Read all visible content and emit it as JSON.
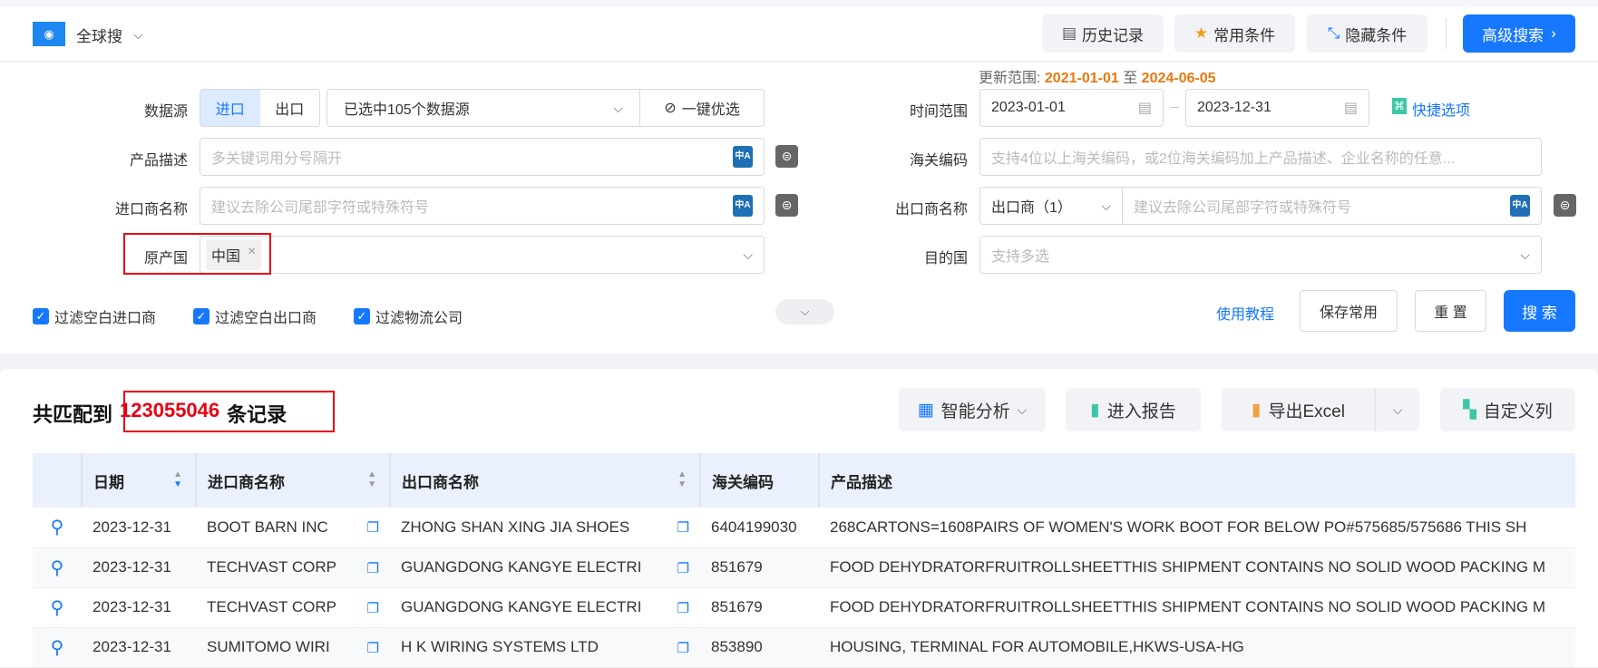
{
  "header": {
    "scope": "全球搜",
    "buttons": {
      "history": "历史记录",
      "favorites": "常用条件",
      "hide": "隐藏条件",
      "advanced": "高级搜索"
    }
  },
  "form": {
    "update_range_label": "更新范围:",
    "update_start": "2021-01-01",
    "update_to": "至",
    "update_end": "2024-06-05",
    "data_source_label": "数据源",
    "import_label": "进口",
    "export_label": "出口",
    "data_source_value": "已选中105个数据源",
    "optimize_label": "一键优选",
    "time_label": "时间范围",
    "date_start": "2023-01-01",
    "date_end": "2023-12-31",
    "quick_label": "快捷选项",
    "product_label": "产品描述",
    "product_placeholder": "多关键词用分号隔开",
    "hs_label": "海关编码",
    "hs_placeholder": "支持4位以上海关编码，或2位海关编码加上产品描述、企业名称的任意...",
    "importer_label": "进口商名称",
    "importer_placeholder": "建议去除公司尾部字符或特殊符号",
    "exporter_label": "出口商名称",
    "exporter_type": "出口商（1）",
    "exporter_placeholder": "建议去除公司尾部字符或特殊符号",
    "origin_label": "原产国",
    "origin_tag": "中国",
    "dest_label": "目的国",
    "dest_placeholder": "支持多选",
    "filters": [
      "过滤空白进口商",
      "过滤空白出口商",
      "过滤物流公司"
    ],
    "tutorial": "使用教程",
    "save": "保存常用",
    "reset": "重 置",
    "search": "搜 索"
  },
  "results": {
    "prefix": "共匹配到",
    "count": "123055046",
    "suffix": "条记录",
    "toolbar": {
      "analysis": "智能分析",
      "report": "进入报告",
      "export": "导出Excel",
      "columns": "自定义列"
    },
    "columns": [
      "日期",
      "进口商名称",
      "出口商名称",
      "海关编码",
      "产品描述"
    ],
    "rows": [
      [
        "2023-12-31",
        "BOOT BARN INC",
        "ZHONG SHAN XING JIA SHOES",
        "6404199030",
        "268CARTONS=1608PAIRS OF WOMEN'S WORK BOOT FOR BELOW PO#575685/575686 THIS SH"
      ],
      [
        "2023-12-31",
        "TECHVAST CORP",
        "GUANGDONG KANGYE ELECTRI",
        "851679",
        "FOOD DEHYDRATORFRUITROLLSHEETTHIS SHIPMENT CONTAINS NO SOLID WOOD PACKING M"
      ],
      [
        "2023-12-31",
        "TECHVAST CORP",
        "GUANGDONG KANGYE ELECTRI",
        "851679",
        "FOOD DEHYDRATORFRUITROLLSHEETTHIS SHIPMENT CONTAINS NO SOLID WOOD PACKING M"
      ],
      [
        "2023-12-31",
        "SUMITOMO WIRI",
        "H K WIRING SYSTEMS LTD",
        "853890",
        "HOUSING, TERMINAL FOR AUTOMOBILE,HKWS-USA-HG"
      ]
    ]
  },
  "colors": {
    "primary": "#1677ff",
    "highlight": "#e8780f",
    "count": "#e60012",
    "annotation_box": "#e60012"
  }
}
